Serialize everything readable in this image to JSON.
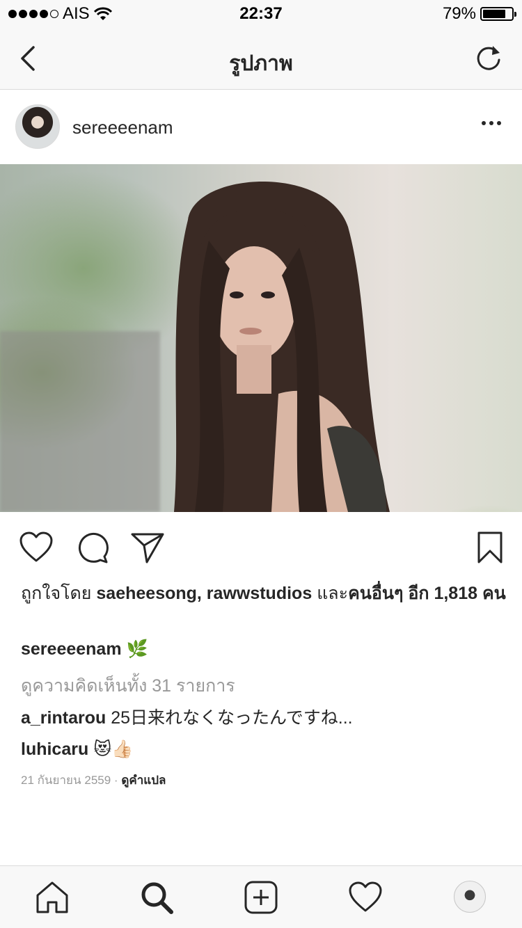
{
  "status_bar": {
    "carrier": "AIS",
    "time": "22:37",
    "battery_percent": "79%",
    "battery_level": 0.79,
    "signal_bars_filled": 4,
    "signal_bars_total": 5,
    "icons": [
      "wifi-icon",
      "battery-icon"
    ]
  },
  "nav": {
    "title": "รูปภาพ",
    "back_icon": "chevron-left-icon",
    "refresh_icon": "refresh-icon"
  },
  "post": {
    "username": "sereeeenam",
    "more_icon": "more-horizontal-icon",
    "actions": {
      "like_icon": "heart-icon",
      "comment_icon": "comment-bubble-icon",
      "share_icon": "paper-plane-icon",
      "save_icon": "bookmark-icon"
    },
    "likes": {
      "prefix": "ถูกใจโดย",
      "users": "saeheesong, rawwstudios",
      "conjunction": "และ",
      "others": "คนอื่นๆ อีก 1,818 คน"
    },
    "caption": {
      "username": "sereeeenam",
      "text": "🌿"
    },
    "view_all_comments": "ดูความคิดเห็นทั้ง 31 รายการ",
    "comments": [
      {
        "username": "a_rintarou",
        "text": "25日来れなくなったんですね..."
      },
      {
        "username": "luhicaru",
        "text": "😻👍🏻"
      }
    ],
    "date": "21 กันยายน 2559",
    "separator": "·",
    "translate_label": "ดูคำแปล"
  },
  "tab_bar": {
    "items": [
      "home-icon",
      "search-icon",
      "add-post-icon",
      "activity-heart-icon",
      "profile-avatar"
    ]
  },
  "colors": {
    "text_primary": "#262626",
    "text_secondary": "#999999",
    "bar_background": "#f8f8f8",
    "divider": "#dbdbdb"
  }
}
